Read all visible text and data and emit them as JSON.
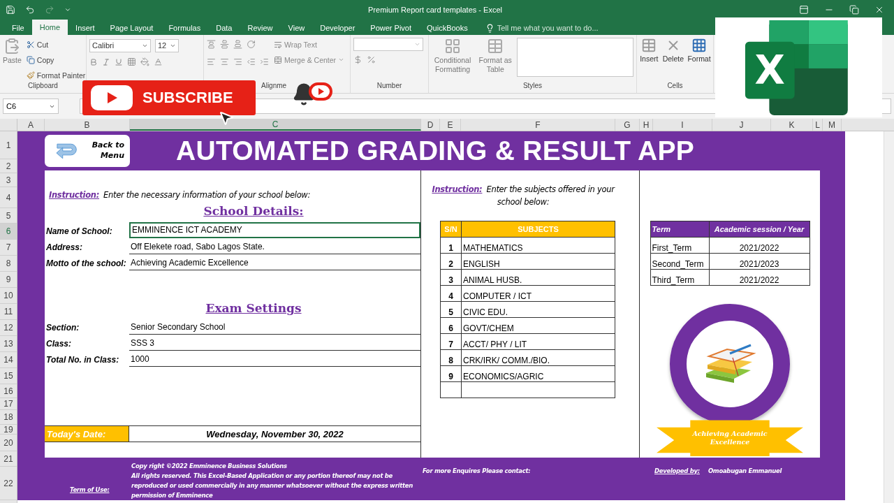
{
  "window": {
    "title": "Premium Report card templates - Excel"
  },
  "ribbon_tabs": [
    {
      "label": "File",
      "selected": false
    },
    {
      "label": "Home",
      "selected": true
    },
    {
      "label": "Insert",
      "selected": false
    },
    {
      "label": "Page Layout",
      "selected": false
    },
    {
      "label": "Formulas",
      "selected": false
    },
    {
      "label": "Data",
      "selected": false
    },
    {
      "label": "Review",
      "selected": false
    },
    {
      "label": "View",
      "selected": false
    },
    {
      "label": "Developer",
      "selected": false
    },
    {
      "label": "Power Pivot",
      "selected": false
    },
    {
      "label": "QuickBooks",
      "selected": false
    }
  ],
  "tell_me": {
    "placeholder": "Tell me what you want to do..."
  },
  "clipboard": {
    "label": "Clipboard",
    "paste": "Paste",
    "cut": "Cut",
    "copy": "Copy",
    "format_painter": "Format Painter"
  },
  "font": {
    "font_name": "Calibri",
    "font_size": "12"
  },
  "alignment": {
    "label": "Alignme",
    "wrap_text": "Wrap Text",
    "merge_center": "Merge & Center"
  },
  "number": {
    "label": "Number"
  },
  "styles": {
    "label": "Styles",
    "conditional_formatting": "Conditional Formatting",
    "format_as_table": "Format as Table"
  },
  "cells": {
    "label": "Cells",
    "insert": "Insert",
    "delete": "Delete",
    "format": "Format"
  },
  "name_box": "C6",
  "columns": [
    {
      "label": "A",
      "selected": false
    },
    {
      "label": "B",
      "selected": false
    },
    {
      "label": "C",
      "selected": true
    },
    {
      "label": "D",
      "selected": false
    },
    {
      "label": "E",
      "selected": false
    },
    {
      "label": "F",
      "selected": false
    },
    {
      "label": "G",
      "selected": false
    },
    {
      "label": "H",
      "selected": false
    },
    {
      "label": "I",
      "selected": false
    },
    {
      "label": "J",
      "selected": false
    },
    {
      "label": "K",
      "selected": false
    },
    {
      "label": "L",
      "selected": false
    },
    {
      "label": "M",
      "selected": false
    }
  ],
  "rows": [
    {
      "label": "1",
      "selected": false
    },
    {
      "label": "2",
      "selected": false
    },
    {
      "label": "3",
      "selected": false
    },
    {
      "label": "4",
      "selected": false
    },
    {
      "label": "5",
      "selected": false
    },
    {
      "label": "6",
      "selected": true
    },
    {
      "label": "7",
      "selected": false
    },
    {
      "label": "8",
      "selected": false
    },
    {
      "label": "9",
      "selected": false
    },
    {
      "label": "10",
      "selected": false
    },
    {
      "label": "11",
      "selected": false
    },
    {
      "label": "12",
      "selected": false
    },
    {
      "label": "13",
      "selected": false
    },
    {
      "label": "14",
      "selected": false
    },
    {
      "label": "15",
      "selected": false
    },
    {
      "label": "16",
      "selected": false
    },
    {
      "label": "17",
      "selected": false
    },
    {
      "label": "18",
      "selected": false
    },
    {
      "label": "19",
      "selected": false
    },
    {
      "label": "20",
      "selected": false
    },
    {
      "label": "21",
      "selected": false
    },
    {
      "label": "22",
      "selected": false
    }
  ],
  "back_button": "Back to Menu",
  "app_title": "AUTOMATED GRADING & RESULT APP",
  "school_section": {
    "instruction_label": "Instruction:",
    "instruction": "Enter the necessary information of your school below:",
    "heading": "School Details:",
    "fields": [
      {
        "label": "Name of School:",
        "value": "EMMINENCE ICT ACADEMY",
        "selected": true
      },
      {
        "label": "Address:",
        "value": "Off Elekete road, Sabo Lagos State.",
        "selected": false
      },
      {
        "label": "Motto of the school:",
        "value": "Achieving Academic Excellence",
        "selected": false
      }
    ]
  },
  "exam_section": {
    "heading": "Exam Settings",
    "fields": [
      {
        "label": "Section:",
        "value": "Senior Secondary School",
        "selected": false
      },
      {
        "label": "Class:",
        "value": "SSS 3",
        "selected": false
      },
      {
        "label": "Total No. in Class:",
        "value": "1000",
        "selected": false
      }
    ]
  },
  "todays_date": {
    "label": "Today's Date:",
    "value": "Wednesday, November 30, 2022"
  },
  "subjects_section": {
    "instruction_label": "Instruction:",
    "instruction": "Enter the subjects offered in your school below:",
    "columns": [
      "S/N",
      "SUBJECTS"
    ],
    "rows": [
      {
        "sn": "1",
        "subject": "MATHEMATICS"
      },
      {
        "sn": "2",
        "subject": "ENGLISH"
      },
      {
        "sn": "3",
        "subject": "ANIMAL HUSB."
      },
      {
        "sn": "4",
        "subject": "COMPUTER / ICT"
      },
      {
        "sn": "5",
        "subject": "CIVIC EDU."
      },
      {
        "sn": "6",
        "subject": "GOVT/CHEM"
      },
      {
        "sn": "7",
        "subject": "ACCT/ PHY / LIT"
      },
      {
        "sn": "8",
        "subject": "CRK/IRK/ COMM./BIO."
      },
      {
        "sn": "9",
        "subject": "ECONOMICS/AGRIC"
      }
    ]
  },
  "terms_table": {
    "columns": [
      "Term",
      "Academic session / Year"
    ],
    "rows": [
      {
        "term": "First_Term",
        "session": "2021/2022"
      },
      {
        "term": "Second_Term",
        "session": "2021/2023"
      },
      {
        "term": "Third_Term",
        "session": "2021/2022"
      }
    ]
  },
  "motto_banner": "Achieving Academic Excellence",
  "footer": {
    "terms_link": "Term of Use:",
    "copyright": [
      "Copy right ©2022 Emminence Business Solutions",
      "All rights reserved. This Excel-Based Application or any portion thereof may not be reproduced or used commercially in any manner whatsoever without the express written permission of Emminence"
    ],
    "contact": "For more Enquires Please contact:",
    "developer_label": "Developed by:",
    "developer": "Omoabugan Emmanuel"
  },
  "overlays": {
    "subscribe": "SUBSCRIBE",
    "logo_letter": "X"
  }
}
